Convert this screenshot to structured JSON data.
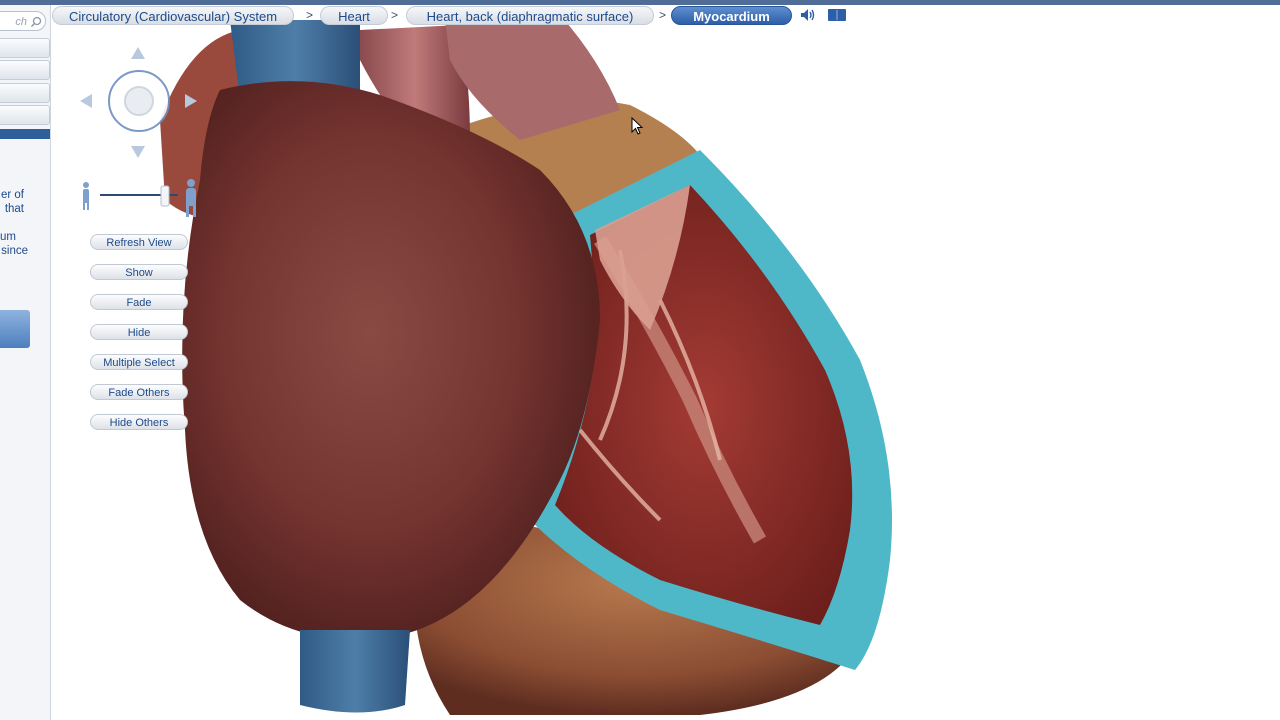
{
  "search": {
    "placeholder": "ch"
  },
  "breadcrumb": [
    {
      "label": "Circulatory (Cardiovascular) System"
    },
    {
      "label": "Heart"
    },
    {
      "label": "Heart, back (diaphragmatic surface)"
    },
    {
      "label": "Myocardium"
    }
  ],
  "breadcrumb_separator": ">",
  "toolbar": {
    "audio_icon": "speaker-icon",
    "book_icon": "book-icon"
  },
  "sidebar_text": [
    "er of",
    "that",
    "um",
    "since"
  ],
  "actions": [
    {
      "label": "Refresh View"
    },
    {
      "label": "Show"
    },
    {
      "label": "Fade"
    },
    {
      "label": "Hide"
    },
    {
      "label": "Multiple Select"
    },
    {
      "label": "Fade Others"
    },
    {
      "label": "Hide Others"
    }
  ],
  "navigation": {
    "icons": [
      "arrow-up-icon",
      "arrow-left-icon",
      "arrow-right-icon",
      "arrow-down-icon",
      "rotate-center-icon"
    ]
  },
  "zoom": {
    "min_icon": "person-small-icon",
    "max_icon": "person-large-icon"
  },
  "colors": {
    "accent": "#2d5ea8",
    "link": "#1d4a8a",
    "myocardium": "#4fb8c8",
    "heart_tissue": "#8a3b38"
  }
}
